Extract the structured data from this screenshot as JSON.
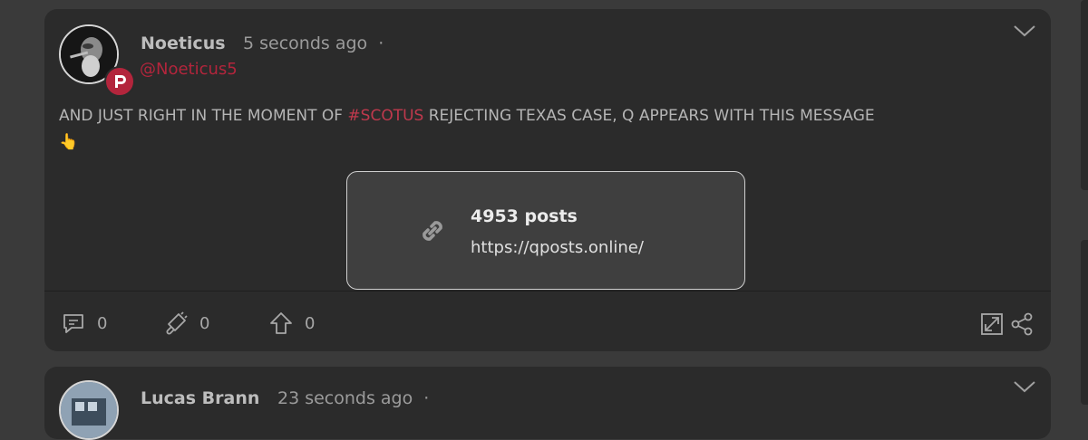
{
  "post1": {
    "author_name": "Noeticus",
    "time_ago": "5 seconds ago",
    "separator": "·",
    "handle": "@Noeticus5",
    "text_before": "AND JUST RIGHT IN THE MOMENT OF ",
    "hashtag": "#SCOTUS",
    "text_after": " REJECTING TEXAS CASE, Q APPEARS WITH THIS MESSAGE",
    "emoji": "👆",
    "link_preview": {
      "title": "4953 posts",
      "url": "https://qposts.online/"
    },
    "actions": {
      "comments": "0",
      "echoes": "0",
      "upvotes": "0"
    }
  },
  "post2": {
    "author_name": "Lucas Brann",
    "time_ago": "23 seconds ago",
    "separator": "·"
  },
  "icons": {
    "badge": "parler-logo-icon",
    "link": "link-icon",
    "comment": "comment-icon",
    "echo": "megaphone-icon",
    "upvote": "upvote-arrow-icon",
    "expand": "expand-icon",
    "share": "share-icon",
    "menu": "chevron-down-icon"
  },
  "colors": {
    "background": "#3a3a3a",
    "card": "#2b2b2b",
    "accent": "#b3253c"
  }
}
